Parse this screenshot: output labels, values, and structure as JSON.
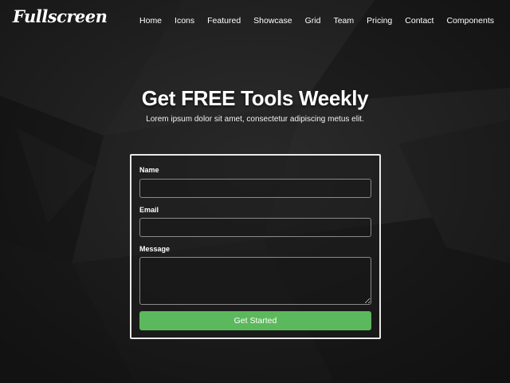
{
  "brand": {
    "name": "Fullscreen"
  },
  "nav": {
    "links": [
      "Home",
      "Icons",
      "Featured",
      "Showcase",
      "Grid",
      "Team",
      "Pricing",
      "Contact",
      "Components"
    ]
  },
  "hero": {
    "title": "Get FREE Tools Weekly",
    "subtitle": "Lorem ipsum dolor sit amet, consectetur adipiscing metus elit."
  },
  "form": {
    "name_label": "Name",
    "name_value": "",
    "email_label": "Email",
    "email_value": "",
    "message_label": "Message",
    "message_value": "",
    "submit_label": "Get Started"
  },
  "colors": {
    "background": "#242424",
    "button": "#5cb85c",
    "panel_border": "#e8e8e8"
  }
}
